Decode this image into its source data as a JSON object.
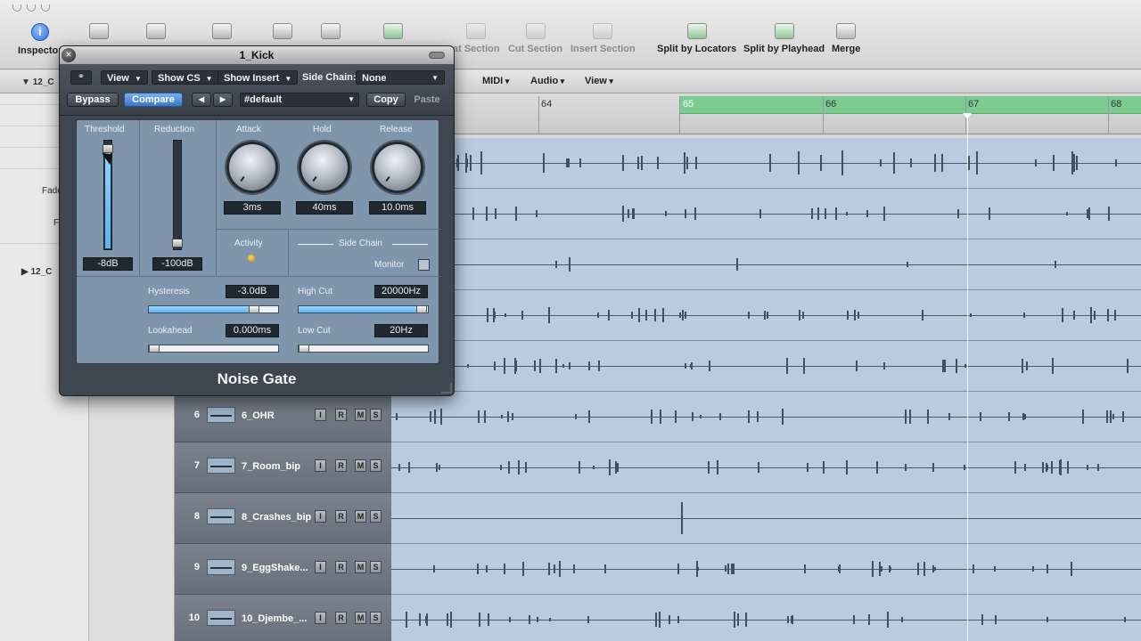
{
  "toolbar": {
    "inspector": "Inspector",
    "cut_section_partial": "at Section",
    "cut_section": "Cut Section",
    "insert_section": "Insert Section",
    "split_locators": "Split by Locators",
    "split_playhead": "Split by Playhead",
    "merge": "Merge"
  },
  "subbar": {
    "midi": "MIDI",
    "audio": "Audio",
    "view": "View"
  },
  "inspector": {
    "region1": "12_C",
    "fade": "Fade",
    "f": "F",
    "region2": "12_C"
  },
  "ruler": {
    "bars": [
      "64",
      "65",
      "66",
      "67",
      "68"
    ]
  },
  "plugin": {
    "title": "1_Kick",
    "menus": {
      "view": "View",
      "show_cs": "Show CS",
      "show_insert": "Show Insert"
    },
    "side_chain_label": "Side Chain:",
    "side_chain_value": "None",
    "bypass": "Bypass",
    "compare": "Compare",
    "prev": "◀",
    "next": "▶",
    "preset": "#default",
    "copy": "Copy",
    "paste": "Paste",
    "threshold_label": "Threshold",
    "threshold_value": "-8dB",
    "reduction_label": "Reduction",
    "reduction_value": "-100dB",
    "attack_label": "Attack",
    "attack_value": "3ms",
    "hold_label": "Hold",
    "hold_value": "40ms",
    "release_label": "Release",
    "release_value": "10.0ms",
    "activity_label": "Activity",
    "sidechain_header": "Side Chain",
    "monitor_label": "Monitor",
    "hysteresis_label": "Hysteresis",
    "hysteresis_value": "-3.0dB",
    "lookahead_label": "Lookahead",
    "lookahead_value": "0.000ms",
    "highcut_label": "High Cut",
    "highcut_value": "20000Hz",
    "lowcut_label": "Low Cut",
    "lowcut_value": "20Hz",
    "name": "Noise Gate"
  },
  "tracks": [
    {
      "num": "6",
      "name": "6_OHR"
    },
    {
      "num": "7",
      "name": "7_Room_bip"
    },
    {
      "num": "8",
      "name": "8_Crashes_bip"
    },
    {
      "num": "9",
      "name": "9_EggShake..."
    },
    {
      "num": "10",
      "name": "10_Djembe_..."
    }
  ],
  "track_buttons": {
    "i": "I",
    "r": "R",
    "m": "M",
    "s": "S"
  }
}
